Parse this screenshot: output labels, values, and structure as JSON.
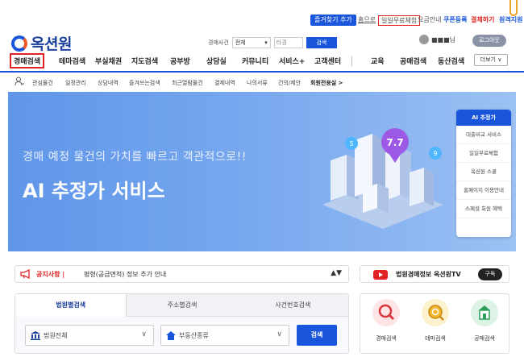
{
  "topbar": {
    "favorite_label": "즐겨찾기 추가",
    "home_label": "홈으로",
    "free_trial_label": "일일무료체험",
    "pricing_label": "요금안내",
    "coupon_label": "쿠폰등록",
    "payment_label": "결제하기",
    "remote_label": "원격지원"
  },
  "logo": {
    "text": "옥션원"
  },
  "search": {
    "label": "경매사건",
    "select_value": "전체",
    "input_placeholder": "타경",
    "button_label": "검색"
  },
  "user": {
    "name": "■■■님",
    "logout_label": "로그아웃"
  },
  "mainnav": {
    "items": [
      "경매검색",
      "테마검색",
      "부실채권",
      "지도검색",
      "공부방",
      "상담실",
      "커뮤니티",
      "서비스+",
      "고객센터",
      "교육",
      "공매검색",
      "동산검색"
    ],
    "more_label": "더보기 ∨"
  },
  "subnav": {
    "items": [
      "관심물건",
      "일정관리",
      "상담내역",
      "즐겨쓰는검색",
      "최근열람물건",
      "결제내역",
      "나의서류",
      "건의/제안",
      "회원전용실 >"
    ]
  },
  "hero": {
    "tagline": "경매 예정 물건의 가치를 빠르고 객관적으로!!",
    "title": "AI 추정가 서비스",
    "pin_values": [
      "5",
      "7.7",
      "9"
    ],
    "menu_header": "AI 추정가",
    "menu_items": [
      "대출비교 서비스",
      "일일무료체험",
      "옥션원 스쿨",
      "홈페이지 이용안내",
      "스페셜 회원 혜택"
    ]
  },
  "notice": {
    "label": "공지사항 |",
    "text": "평형(공급면적) 정보 추가 안내",
    "arrows": "▲▼"
  },
  "tv": {
    "text": "법원경매정보 옥션원TV",
    "subscribe_label": "구독"
  },
  "search_panel": {
    "tabs": [
      "법원별검색",
      "주소별검색",
      "사건번호검색"
    ],
    "court_value": "법원전체",
    "type_value": "부동산종류",
    "button_label": "검색"
  },
  "quick": {
    "items": [
      {
        "label": "경매검색"
      },
      {
        "label": "테마검색"
      },
      {
        "label": "공매검색"
      }
    ]
  },
  "colors": {
    "brand_blue": "#1a56db",
    "accent_red": "#e02424",
    "hero_blue": "#79a9ef"
  }
}
